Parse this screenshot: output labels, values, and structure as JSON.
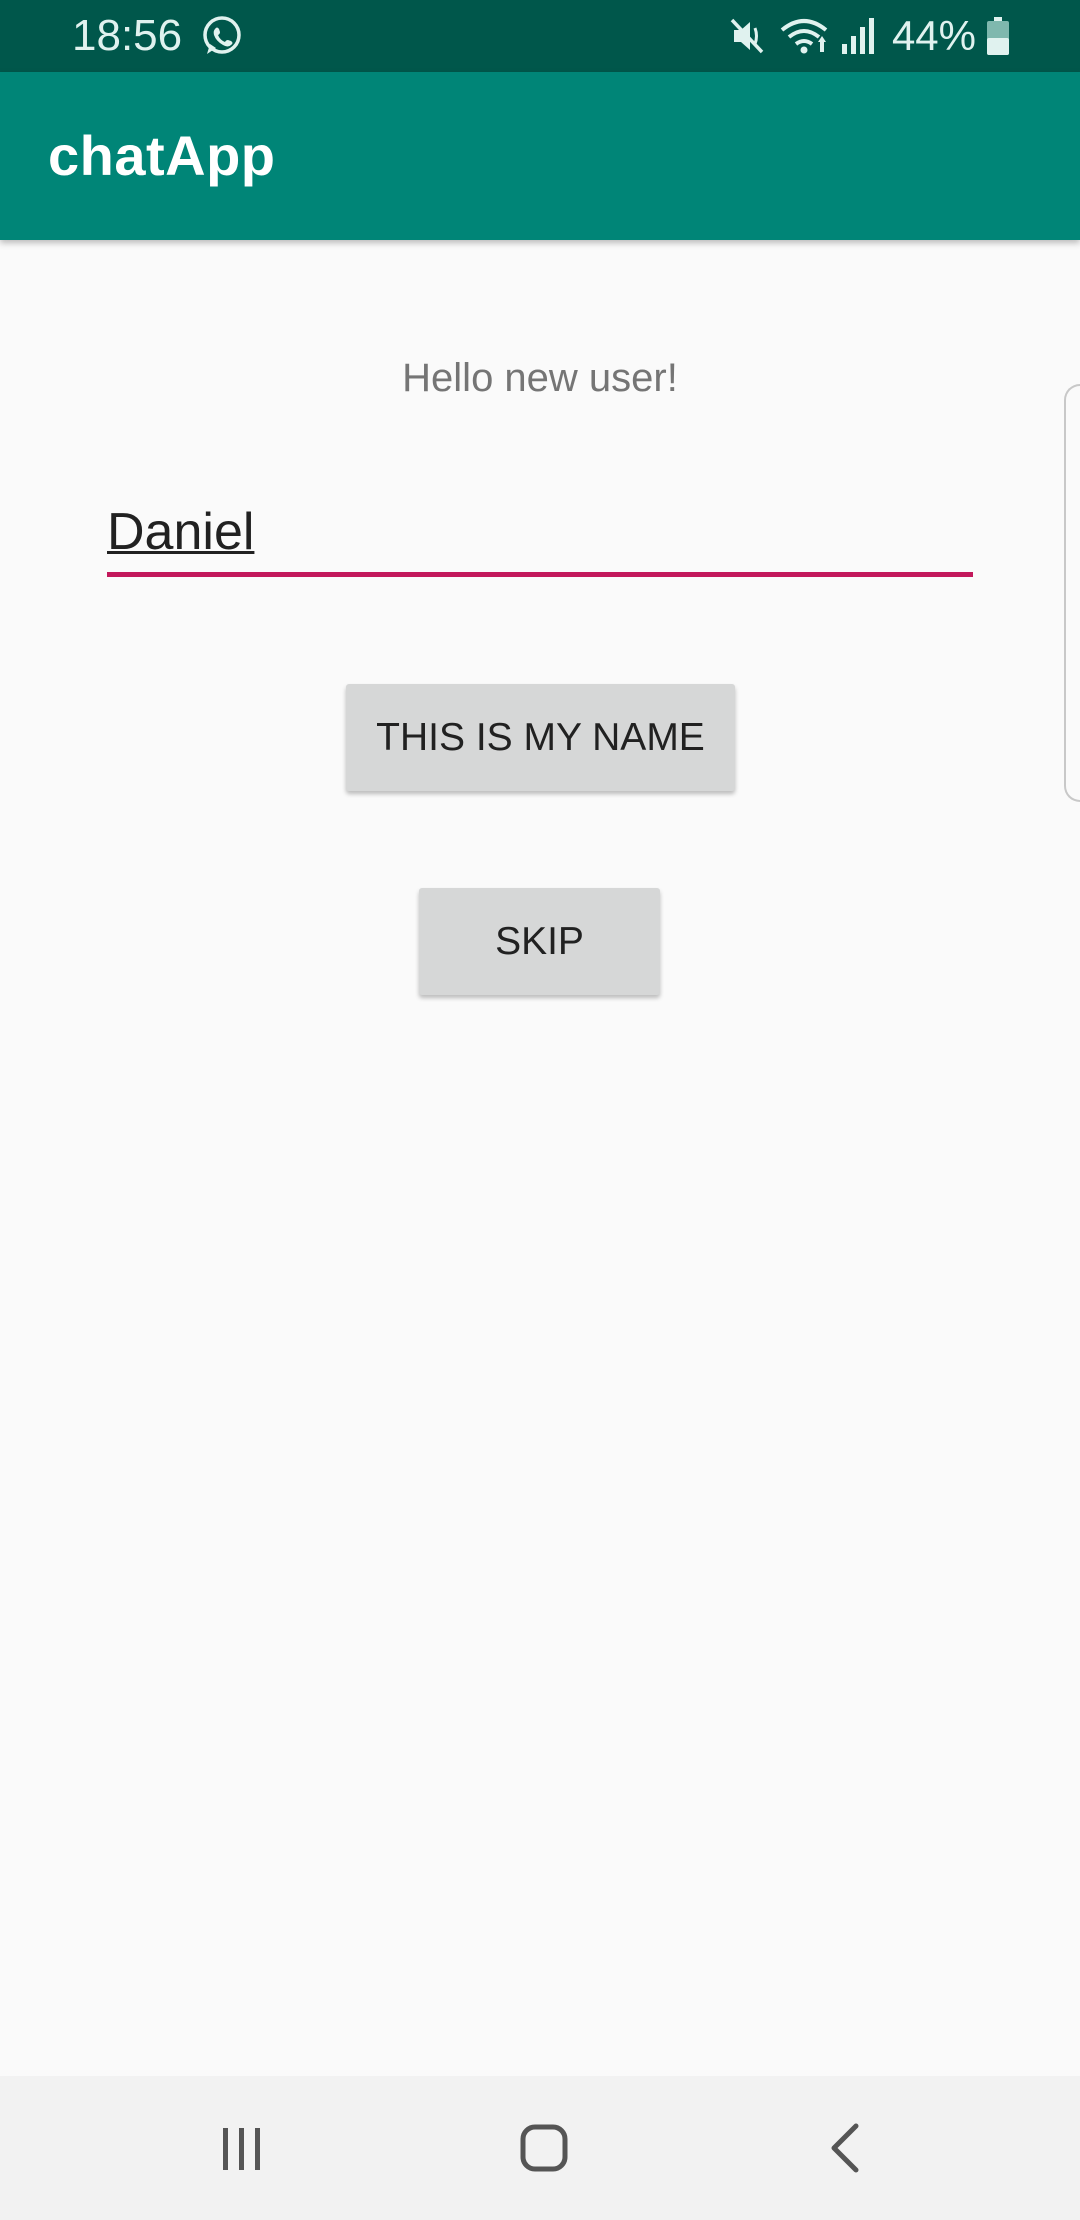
{
  "status_bar": {
    "time": "18:56",
    "battery": "44%",
    "icons": [
      "whatsapp-icon",
      "mute-icon",
      "wifi-icon",
      "signal-icon",
      "battery-icon"
    ]
  },
  "app_bar": {
    "title": "chatApp"
  },
  "main": {
    "greeting": "Hello new user!",
    "name_input_value": "Daniel",
    "confirm_button_label": "THIS IS MY NAME",
    "skip_button_label": "SKIP"
  },
  "nav_bar": {
    "icons": [
      "recent-apps-icon",
      "home-icon",
      "back-icon"
    ]
  },
  "colors": {
    "status_bar": "#00574b",
    "app_bar": "#008577",
    "accent": "#c2185b",
    "background": "#fafafa",
    "button": "#d6d7d7"
  }
}
